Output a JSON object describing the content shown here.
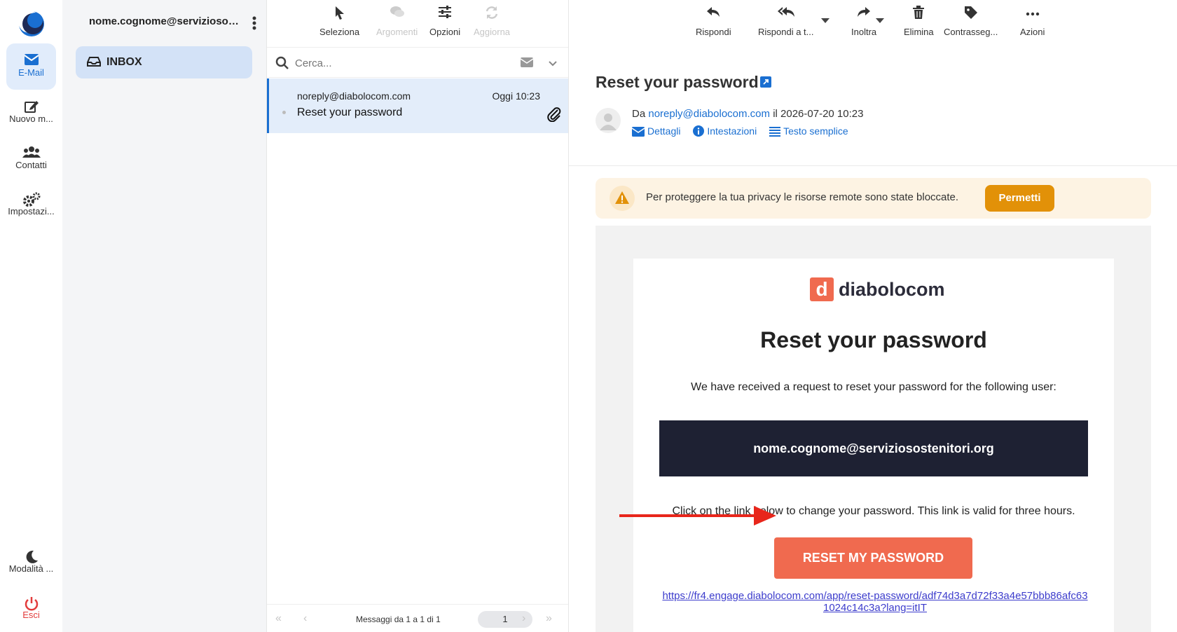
{
  "taskmenu": {
    "items": [
      {
        "label": "E-Mail",
        "icon": "envelope-icon"
      },
      {
        "label": "Nuovo m...",
        "icon": "compose-icon"
      },
      {
        "label": "Contatti",
        "icon": "users-icon"
      },
      {
        "label": "Impostazi...",
        "icon": "gears-icon"
      }
    ],
    "dark_mode_label": "Modalità ...",
    "logout_label": "Esci"
  },
  "folders": {
    "account": "nome.cognome@serviziosost...",
    "inbox_label": "INBOX"
  },
  "list_toolbar": {
    "select": "Seleziona",
    "threads": "Argomenti",
    "options": "Opzioni",
    "refresh": "Aggiorna"
  },
  "search": {
    "placeholder": "Cerca..."
  },
  "messages": [
    {
      "from": "noreply@diabolocom.com",
      "date": "Oggi 10:23",
      "subject": "Reset your password"
    }
  ],
  "pager": {
    "text": "Messaggi da 1 a 1 di 1",
    "page": "1"
  },
  "reader_toolbar": {
    "reply": "Rispondi",
    "reply_all": "Rispondi a t...",
    "forward": "Inoltra",
    "delete": "Elimina",
    "flag": "Contrasseg...",
    "actions": "Azioni"
  },
  "email": {
    "subject": "Reset your password",
    "from_prefix": "Da",
    "from": "noreply@diabolocom.com",
    "date_prefix": "il",
    "date": "2026-07-20 10:23",
    "links": {
      "details": "Dettagli",
      "headers": "Intestazioni",
      "plain": "Testo semplice"
    },
    "notice": "Per proteggere la tua privacy le risorse remote sono state bloccate.",
    "allow_label": "Permetti",
    "body": {
      "brand": "diabolocom",
      "brand_letter": "d",
      "title": "Reset your password",
      "intro": "We have received a request to reset your password for the following user:",
      "user": "nome.cognome@serviziosostenitori.org",
      "instruction": "Click on the link below to change your password. This link is valid for three hours.",
      "button": "RESET MY PASSWORD",
      "link": "https://fr4.engage.diabolocom.com/app/reset-password/adf74d3a7d72f33a4e57bbb86afc631024c14c3a?lang=itIT"
    }
  },
  "colors": {
    "accent": "#1a6fd1",
    "brand": "#f06a4f",
    "warning": "#e29108",
    "arrow": "#e8261b"
  }
}
